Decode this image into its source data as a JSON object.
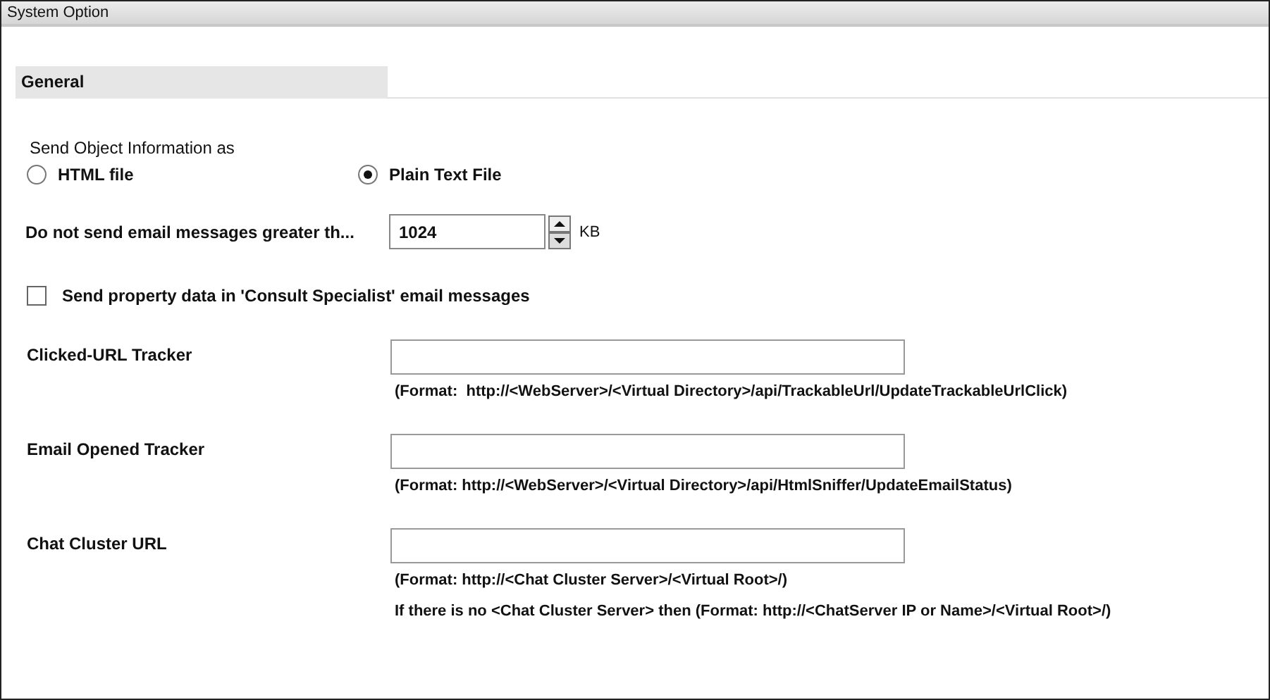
{
  "window": {
    "title": "System Option"
  },
  "section": {
    "title": "General"
  },
  "send_object": {
    "label": "Send Object Information as",
    "options": [
      {
        "label": "HTML file",
        "selected": false
      },
      {
        "label": "Plain Text File",
        "selected": true
      }
    ]
  },
  "max_size": {
    "label": "Do not send email messages greater th...",
    "value": "1024",
    "unit": "KB"
  },
  "consult_checkbox": {
    "label": "Send property data in 'Consult Specialist' email messages",
    "checked": false
  },
  "url_fields": [
    {
      "label": "Clicked-URL Tracker",
      "notes": [
        "(Format:  http://<WebServer>/<Virtual Directory>/api/TrackableUrl/UpdateTrackableUrlClick)"
      ]
    },
    {
      "label": "Email Opened Tracker",
      "notes": [
        "(Format: http://<WebServer>/<Virtual Directory>/api/HtmlSniffer/UpdateEmailStatus)"
      ]
    },
    {
      "label": "Chat Cluster URL",
      "notes": [
        "(Format: http://<Chat Cluster Server>/<Virtual Root>/)",
        "If there is no <Chat Cluster Server> then (Format: http://<ChatServer IP or Name>/<Virtual Root>/)"
      ]
    }
  ]
}
